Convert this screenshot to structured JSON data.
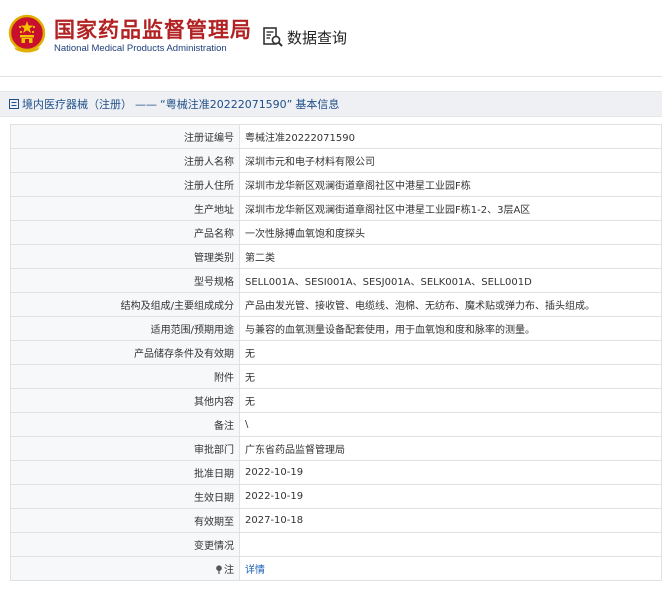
{
  "header": {
    "brand_cn": "国家药品监督管理局",
    "brand_en": "National Medical Products Administration",
    "query_label": "数据查询",
    "brand_color": "#b22222"
  },
  "breadcrumb": {
    "section": "境内医疗器械（注册）",
    "separator": "——",
    "title": "“粤械注准20222071590”",
    "suffix": "基本信息"
  },
  "detail": {
    "rows": [
      {
        "label": "注册证编号",
        "value": "粤械注准20222071590"
      },
      {
        "label": "注册人名称",
        "value": "深圳市元和电子材料有限公司"
      },
      {
        "label": "注册人住所",
        "value": "深圳市龙华新区观澜街道章阁社区中港星工业园F栋"
      },
      {
        "label": "生产地址",
        "value": "深圳市龙华新区观澜街道章阁社区中港星工业园F栋1-2、3层A区"
      },
      {
        "label": "产品名称",
        "value": "一次性脉搏血氧饱和度探头"
      },
      {
        "label": "管理类别",
        "value": "第二类"
      },
      {
        "label": "型号规格",
        "value": "SELL001A、SESI001A、SESJ001A、SELK001A、SELL001D"
      },
      {
        "label": "结构及组成/主要组成成分",
        "value": "产品由发光管、接收管、电缆线、泡棉、无纺布、魔术贴或弹力布、插头组成。"
      },
      {
        "label": "适用范围/预期用途",
        "value": "与兼容的血氧测量设备配套使用，用于血氧饱和度和脉率的测量。"
      },
      {
        "label": "产品储存条件及有效期",
        "value": "无"
      },
      {
        "label": "附件",
        "value": "无"
      },
      {
        "label": "其他内容",
        "value": "无"
      },
      {
        "label": "备注",
        "value": "\\"
      },
      {
        "label": "审批部门",
        "value": "广东省药品监督管理局"
      },
      {
        "label": "批准日期",
        "value": "2022-10-19"
      },
      {
        "label": "生效日期",
        "value": "2022-10-19"
      },
      {
        "label": "有效期至",
        "value": "2027-10-18"
      },
      {
        "label": "变更情况",
        "value": ""
      },
      {
        "label": "注",
        "value": "详情"
      }
    ]
  }
}
